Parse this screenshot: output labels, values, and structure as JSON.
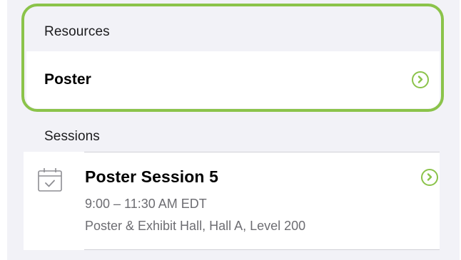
{
  "resources": {
    "header": "Resources",
    "items": [
      {
        "label": "Poster",
        "icon": "chevron-right-circle-icon"
      }
    ]
  },
  "sessions": {
    "header": "Sessions",
    "items": [
      {
        "title": "Poster Session 5",
        "time": "9:00 – 11:30 AM EDT",
        "location": "Poster & Exhibit Hall, Hall A, Level 200",
        "icon": "calendar-check-icon",
        "action_icon": "chevron-right-circle-icon"
      }
    ]
  },
  "colors": {
    "accent": "#8bc34a",
    "background": "#f2f2f7",
    "secondary_text": "#6d6d72",
    "separator": "#d1d1d6"
  }
}
